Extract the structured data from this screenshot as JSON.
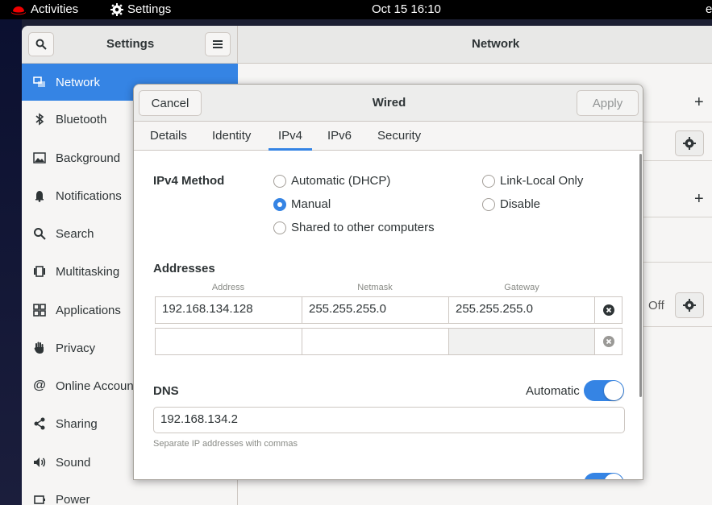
{
  "topbar": {
    "activities": "Activities",
    "app_name": "Settings",
    "clock": "Oct 15  16:10",
    "user_initial": "e"
  },
  "settings_window": {
    "sidebar_title": "Settings",
    "page_title": "Network",
    "sidebar_items": [
      {
        "label": "Network",
        "icon": "network-icon"
      },
      {
        "label": "Bluetooth",
        "icon": "bluetooth-icon"
      },
      {
        "label": "Background",
        "icon": "background-icon"
      },
      {
        "label": "Notifications",
        "icon": "bell-icon"
      },
      {
        "label": "Search",
        "icon": "search-icon"
      },
      {
        "label": "Multitasking",
        "icon": "multitasking-icon"
      },
      {
        "label": "Applications",
        "icon": "grid-icon"
      },
      {
        "label": "Privacy",
        "icon": "hand-icon"
      },
      {
        "label": "Online Accounts",
        "icon": "at-icon"
      },
      {
        "label": "Sharing",
        "icon": "share-icon"
      },
      {
        "label": "Sound",
        "icon": "speaker-icon"
      },
      {
        "label": "Power",
        "icon": "power-icon"
      }
    ],
    "off_label": "Off"
  },
  "dialog": {
    "title": "Wired",
    "cancel_label": "Cancel",
    "apply_label": "Apply",
    "tabs": [
      "Details",
      "Identity",
      "IPv4",
      "IPv6",
      "Security"
    ],
    "active_tab": "IPv4",
    "ipv4_method_label": "IPv4 Method",
    "methods": {
      "automatic": "Automatic (DHCP)",
      "manual": "Manual",
      "shared": "Shared to other computers",
      "link_local": "Link-Local Only",
      "disable": "Disable"
    },
    "selected_method": "Manual",
    "addresses_label": "Addresses",
    "columns": [
      "Address",
      "Netmask",
      "Gateway"
    ],
    "address_rows": [
      {
        "address": "192.168.134.128",
        "netmask": "255.255.255.0",
        "gateway": "255.255.255.0"
      },
      {
        "address": "",
        "netmask": "",
        "gateway": ""
      }
    ],
    "dns_label": "DNS",
    "dns_automatic_label": "Automatic",
    "dns_automatic_on": true,
    "dns_value": "192.168.134.2",
    "dns_hint": "Separate IP addresses with commas"
  },
  "colors": {
    "accent": "#3584e4",
    "topbar": "#000000"
  }
}
